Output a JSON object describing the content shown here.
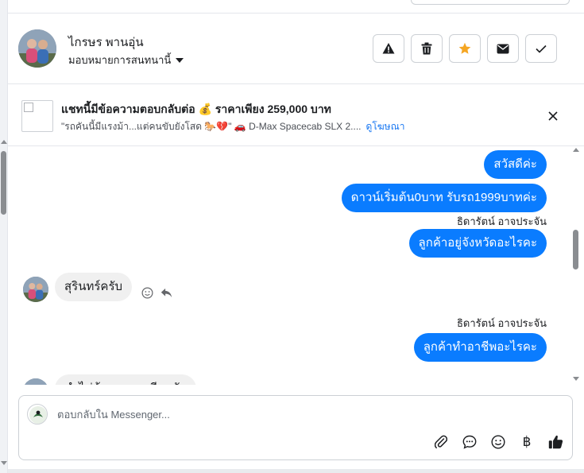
{
  "header": {
    "user_name": "ไกรษร พานอุ่น",
    "assign_label": "มอบหมายการสนทนานี้",
    "actions": [
      {
        "icon": "warning-icon",
        "color": "#1c1e21"
      },
      {
        "icon": "trash-icon",
        "color": "#1c1e21"
      },
      {
        "icon": "star-icon",
        "color": "#f5a623"
      },
      {
        "icon": "envelope-icon",
        "color": "#1c1e21"
      },
      {
        "icon": "check-icon",
        "color": "#1c1e21"
      }
    ]
  },
  "ad": {
    "title": "แชทนี้มีข้อความตอบกลับต่อ 💰 ราคาเพียง 259,000 บาท",
    "subtitle": "\"รถคันนี้มีแรงม้า...แต่คนขับยังโสด 🐎💔\" 🚗 D-Max Spacecab SLX 2....",
    "link": "ดูโฆษณา"
  },
  "messages": [
    {
      "type": "out",
      "text": "สวัสดีค่ะ"
    },
    {
      "type": "out",
      "text": "ดาวน์เริ่มต้น0บาท รับรถ1999บาทค่ะ"
    },
    {
      "type": "out",
      "sender": "ธิดารัตน์ อาจประจัน",
      "text": "ลูกค้าอยู่จังหวัดอะไรคะ"
    },
    {
      "type": "in",
      "text": "สุรินทร์ครับ"
    },
    {
      "type": "out",
      "sender": "ธิดารัตน์ อาจประจัน",
      "text": "ลูกค้าทำอาชีพอะไรคะ"
    },
    {
      "type": "in",
      "text": "ทำไม่ต้องถามอาชีพครับ"
    }
  ],
  "composer": {
    "placeholder": "ตอบกลับใน Messenger...",
    "tools": [
      "paperclip-icon",
      "speech-bubble-icon",
      "emoji-icon",
      "baht-icon",
      "thumbs-up-icon"
    ],
    "baht_symbol": "฿"
  },
  "colors": {
    "accent": "#0a7cff",
    "link": "#1877f2",
    "star": "#f5a623"
  }
}
